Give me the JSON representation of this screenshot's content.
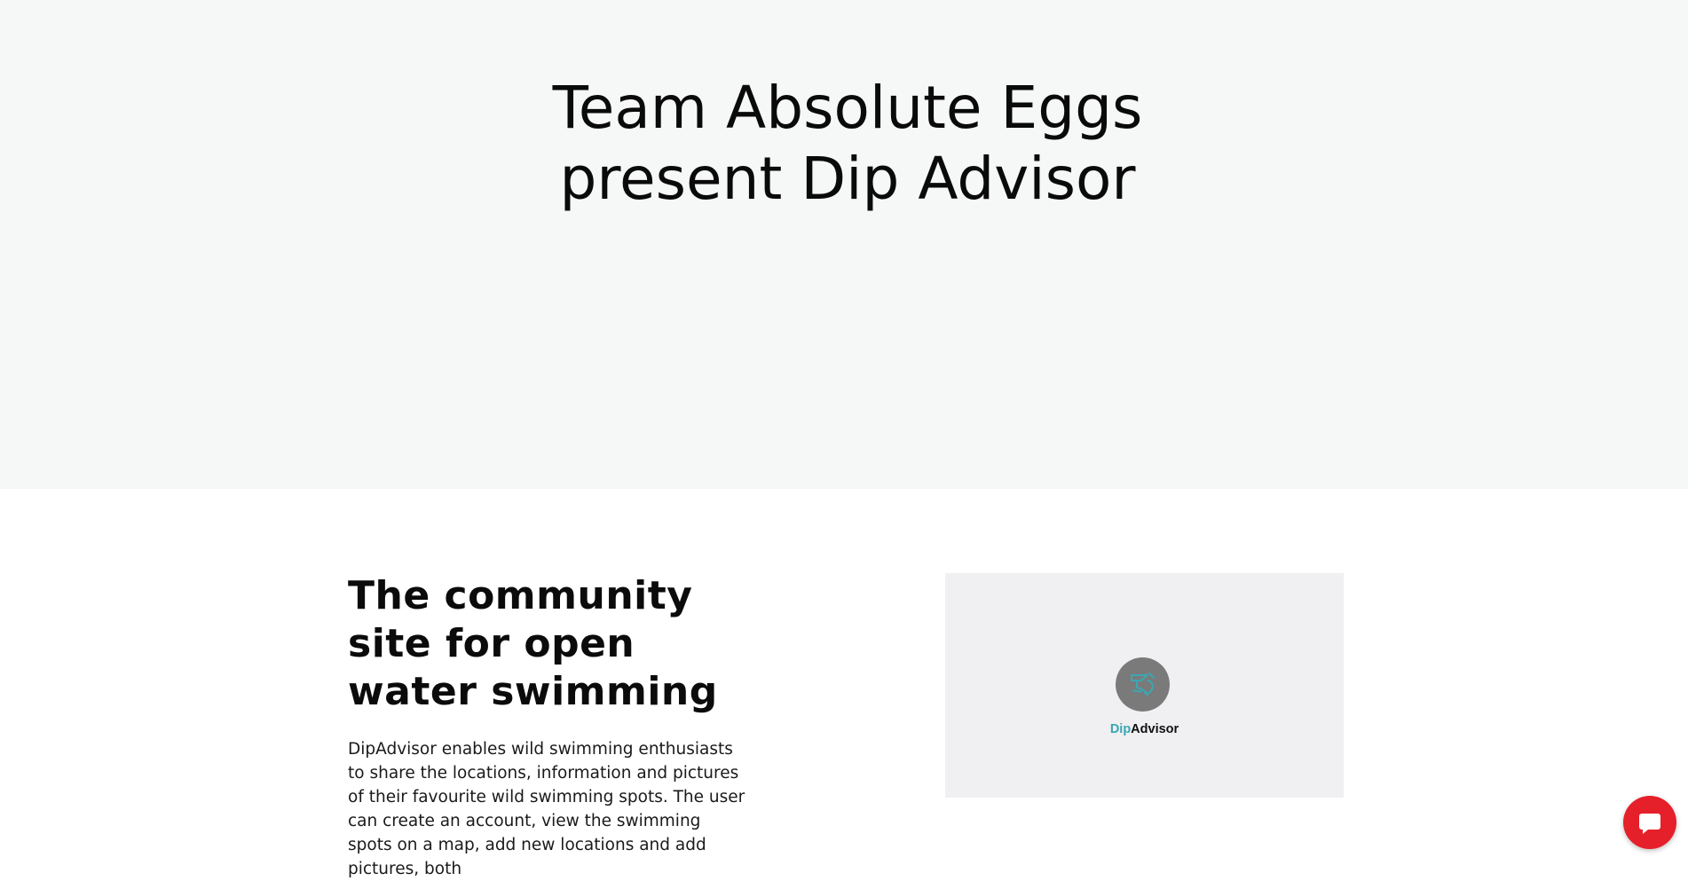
{
  "hero": {
    "title": "Team Absolute Eggs present Dip Advisor"
  },
  "section": {
    "heading": "The community site for open water swimming",
    "body": "DipAdvisor enables wild swimming enthusiasts to share the locations, information and pictures of their favourite wild swimming spots. The user can create an account, view the swimming spots on a map, add new locations and add pictures, both"
  },
  "media": {
    "logo_icon": "swimmer-icon",
    "logo_word_accent": "Dip",
    "logo_word_rest": "Advisor",
    "logo_circle_color": "#7a7a7a",
    "logo_accent_color": "#3aa7b3"
  },
  "chat": {
    "icon": "chat-bubble-icon",
    "color": "#e5202a"
  }
}
